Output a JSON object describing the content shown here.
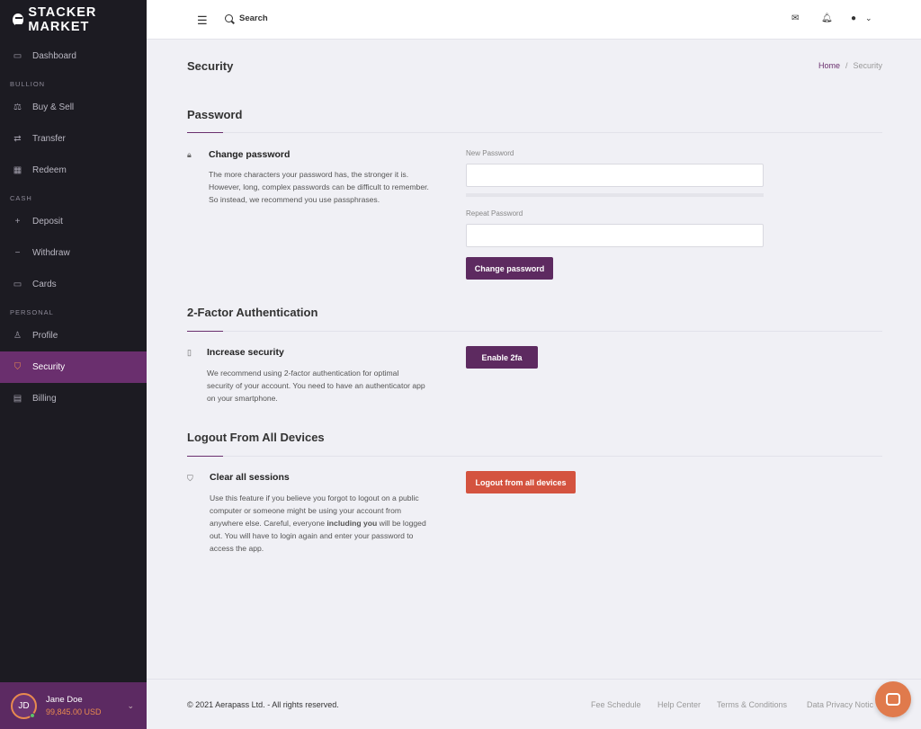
{
  "app": {
    "brand": "STACKER MARKET"
  },
  "sidebar": {
    "items": [
      {
        "label": "Dashboard",
        "icon": "monitor-icon"
      },
      {
        "section": "BULLION"
      },
      {
        "label": "Buy & Sell",
        "icon": "scale-icon"
      },
      {
        "label": "Transfer",
        "icon": "transfer-icon"
      },
      {
        "label": "Redeem",
        "icon": "box-icon"
      },
      {
        "section": "CASH"
      },
      {
        "label": "Deposit",
        "icon": "plus-icon"
      },
      {
        "label": "Withdraw",
        "icon": "minus-icon"
      },
      {
        "label": "Cards",
        "icon": "card-icon"
      },
      {
        "section": "PERSONAL"
      },
      {
        "label": "Profile",
        "icon": "user-icon"
      },
      {
        "label": "Security",
        "icon": "shield-icon",
        "active": true
      },
      {
        "label": "Billing",
        "icon": "file-icon"
      }
    ],
    "user": {
      "initials": "JD",
      "name": "Jane Doe",
      "balance": "99,845.00 USD"
    }
  },
  "topbar": {
    "search_label": "Search",
    "icons": [
      "menu-icon",
      "search-icon",
      "mail-icon",
      "bell-icon",
      "account-icon",
      "chevron-down-icon"
    ]
  },
  "page": {
    "title": "Security",
    "breadcrumb": {
      "home": "Home",
      "separator": "/",
      "current": "Security"
    }
  },
  "password": {
    "section_title": "Password",
    "heading": "Change password",
    "description": "The more characters your password has, the stronger it is. However, long, complex passwords can be difficult to remember. So instead, we recommend you use passphrases.",
    "new_label": "New Password",
    "new_value": "",
    "repeat_label": "Repeat Password",
    "repeat_value": "",
    "button": "Change password"
  },
  "twofa": {
    "section_title": "2-Factor Authentication",
    "heading": "Increase security",
    "description": "We recommend using 2-factor authentication for optimal security of your account. You need to have an authenticator app on your smartphone.",
    "button": "Enable 2fa"
  },
  "logout": {
    "section_title": "Logout From All Devices",
    "heading": "Clear all sessions",
    "description_before": "Use this feature if you believe you forgot to logout on a public computer or someone might be using your account from anywhere else. Careful, everyone ",
    "description_bold": "including you",
    "description_after": " will be logged out. You will have to login again and enter your password to access the app.",
    "button": "Logout from all devices"
  },
  "footer": {
    "copyright": "© 2021 Aerapass Ltd. - All rights reserved.",
    "links": [
      "Fee Schedule",
      "Help Center",
      "Terms & Conditions",
      "Data Privacy Notic"
    ]
  },
  "colors": {
    "sidebar_bg": "#1c1b22",
    "accent_purple": "#5d2a60",
    "accent_orange": "#e88a4f",
    "danger": "#d4533f"
  }
}
